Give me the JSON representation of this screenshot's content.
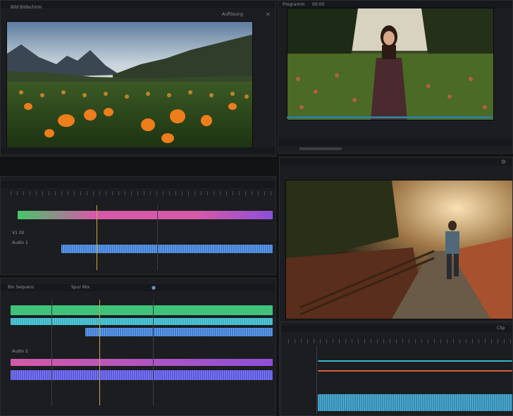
{
  "top_left_panel": {
    "header_left": "Bild Bildschirm",
    "header_right": "Auflösung"
  },
  "top_right_panel": {
    "header_left": "Programm",
    "header_num": "00:00"
  },
  "left_timeline_upper": {
    "label_a": "V1 00",
    "label_b": "Audio 1"
  },
  "left_timeline_lower": {
    "header_left": "Bin Sequenz",
    "header_mid": "Spur Mix",
    "label_c": "Audio 2"
  },
  "right_timeline": {
    "header_right": "Clip"
  },
  "colors": {
    "accent": "#c8a94a",
    "track_green": "#3fc27a",
    "track_pink": "#d45aa8",
    "track_blue": "#3f7fd6",
    "track_cyan": "#35b6c9",
    "track_purple": "#8e4fd8"
  }
}
